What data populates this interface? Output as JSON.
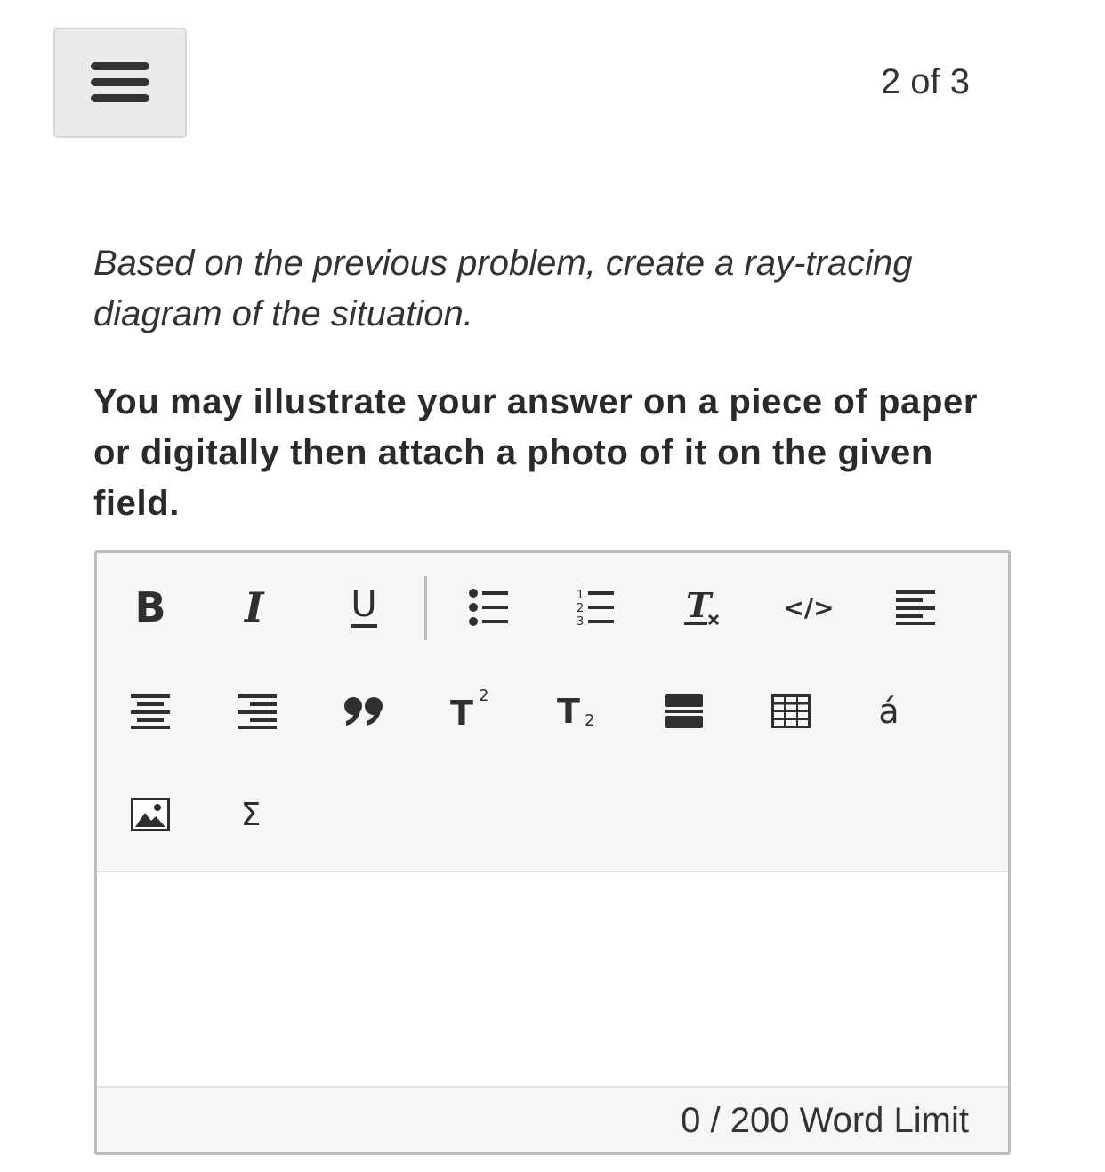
{
  "header": {
    "menu_icon": "hamburger-menu-icon",
    "page_counter": "2 of 3"
  },
  "question": {
    "prompt": "Based on the previous problem, create a ray-tracing diagram of the situation.",
    "instruction": "You may illustrate your answer on a piece of paper or digitally then attach a photo of it on the given field."
  },
  "editor": {
    "toolbar_buttons": [
      {
        "name": "bold",
        "icon": "bold-icon",
        "glyph": "B"
      },
      {
        "name": "italic",
        "icon": "italic-icon",
        "glyph": "I"
      },
      {
        "name": "underline",
        "icon": "underline-icon",
        "glyph": "U"
      },
      {
        "name": "bulleted-list",
        "icon": "bulleted-list-icon"
      },
      {
        "name": "numbered-list",
        "icon": "numbered-list-icon"
      },
      {
        "name": "clear-formatting",
        "icon": "clear-formatting-icon",
        "glyph": "T"
      },
      {
        "name": "code",
        "icon": "code-icon",
        "glyph": "</>"
      },
      {
        "name": "align-left",
        "icon": "align-left-icon"
      },
      {
        "name": "align-center",
        "icon": "align-center-icon"
      },
      {
        "name": "align-right",
        "icon": "align-right-icon"
      },
      {
        "name": "blockquote",
        "icon": "quote-icon",
        "glyph": "99"
      },
      {
        "name": "superscript",
        "icon": "superscript-icon",
        "glyph": "T",
        "sub": "2"
      },
      {
        "name": "subscript",
        "icon": "subscript-icon",
        "glyph": "T",
        "sub": "2"
      },
      {
        "name": "horizontal-rule",
        "icon": "horizontal-rule-icon"
      },
      {
        "name": "table",
        "icon": "table-icon"
      },
      {
        "name": "special-characters",
        "icon": "special-character-icon",
        "glyph": "á"
      },
      {
        "name": "insert-image",
        "icon": "image-icon"
      },
      {
        "name": "math-equation",
        "icon": "sigma-icon",
        "glyph": "Σ"
      }
    ],
    "content": "",
    "word_count": "0",
    "word_limit_text": " / 200 Word Limit"
  }
}
